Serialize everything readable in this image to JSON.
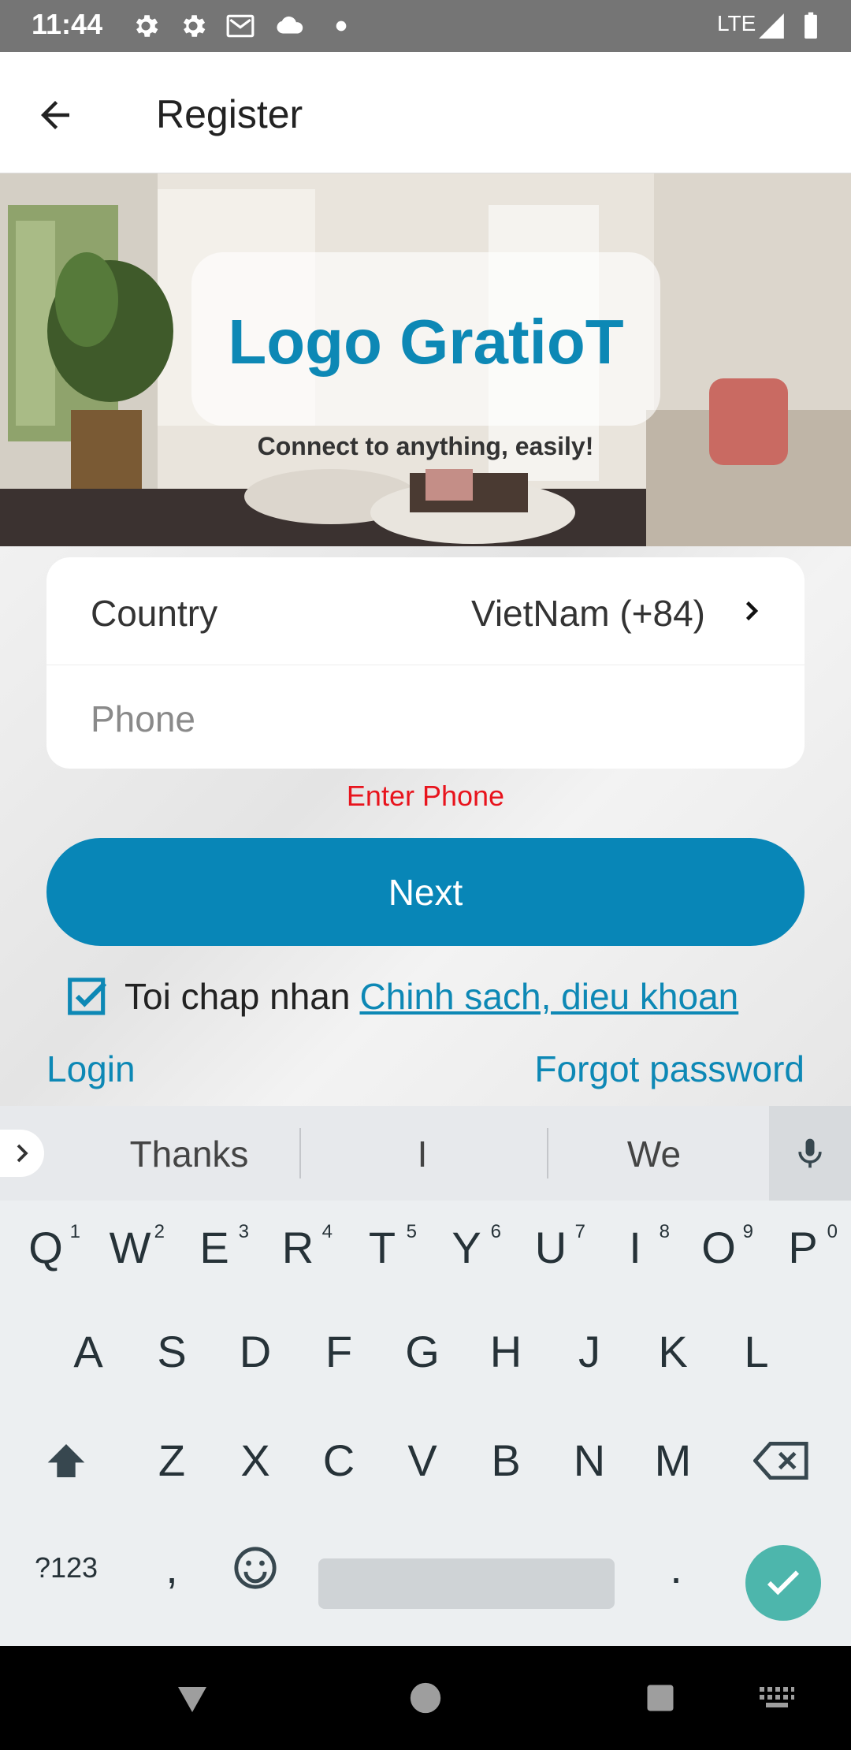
{
  "status_bar": {
    "time": "11:44",
    "network": "LTE",
    "icons": [
      "gear-icon",
      "gear-icon",
      "gmail-icon",
      "cloud-icon",
      "dot-icon",
      "signal-icon",
      "battery-icon"
    ]
  },
  "app_bar": {
    "title": "Register",
    "back_icon": "arrow-left-icon"
  },
  "hero": {
    "logo_text": "Logo GratioT",
    "tagline": "Connect to anything, easily!"
  },
  "form": {
    "country_label": "Country",
    "country_value": "VietNam (+84)",
    "phone_placeholder": "Phone",
    "phone_value": "",
    "error_text": "Enter Phone",
    "next_label": "Next",
    "agree_text": "Toi chap nhan",
    "agree_checked": true,
    "policy_link": "Chinh sach, dieu khoan",
    "login_link": "Login",
    "forgot_link": "Forgot password"
  },
  "suggestions": [
    "Thanks",
    "I",
    "We"
  ],
  "keyboard": {
    "row1": [
      {
        "key": "Q",
        "hint": "1"
      },
      {
        "key": "W",
        "hint": "2"
      },
      {
        "key": "E",
        "hint": "3"
      },
      {
        "key": "R",
        "hint": "4"
      },
      {
        "key": "T",
        "hint": "5"
      },
      {
        "key": "Y",
        "hint": "6"
      },
      {
        "key": "U",
        "hint": "7"
      },
      {
        "key": "I",
        "hint": "8"
      },
      {
        "key": "O",
        "hint": "9"
      },
      {
        "key": "P",
        "hint": "0"
      }
    ],
    "row2": [
      "A",
      "S",
      "D",
      "F",
      "G",
      "H",
      "J",
      "K",
      "L"
    ],
    "row3": [
      "Z",
      "X",
      "C",
      "V",
      "B",
      "N",
      "M"
    ],
    "symbols_label": "?123",
    "comma": ",",
    "period": "."
  },
  "colors": {
    "brand": "#0886b7",
    "link": "#0d88b5",
    "error": "#e8141d",
    "enter_key": "#4db6ac"
  }
}
